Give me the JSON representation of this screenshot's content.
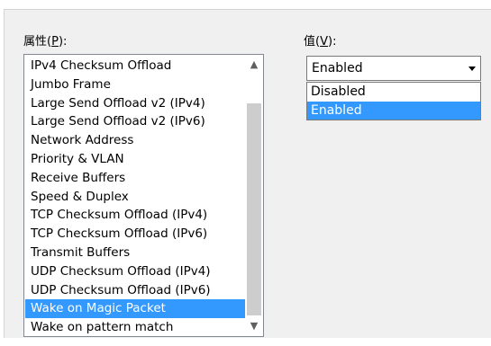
{
  "property": {
    "label_text": "属性",
    "label_mnemonic": "P",
    "items": [
      "IPv4 Checksum Offload",
      "Jumbo Frame",
      "Large Send Offload v2 (IPv4)",
      "Large Send Offload v2 (IPv6)",
      "Network Address",
      "Priority & VLAN",
      "Receive Buffers",
      "Speed & Duplex",
      "TCP Checksum Offload (IPv4)",
      "TCP Checksum Offload (IPv6)",
      "Transmit Buffers",
      "UDP Checksum Offload (IPv4)",
      "UDP Checksum Offload (IPv6)",
      "Wake on Magic Packet",
      "Wake on pattern match"
    ],
    "selected_index": 13
  },
  "value": {
    "label_text": "值",
    "label_mnemonic": "V",
    "current": "Enabled",
    "options": [
      "Disabled",
      "Enabled"
    ],
    "highlighted_index": 1
  },
  "colors": {
    "selection": "#3399ff",
    "dialog_bg": "#f0f0f0"
  },
  "icons": {
    "scroll_up": "chevron-up-icon",
    "scroll_down": "chevron-down-icon",
    "combo_arrow": "dropdown-arrow-icon"
  }
}
